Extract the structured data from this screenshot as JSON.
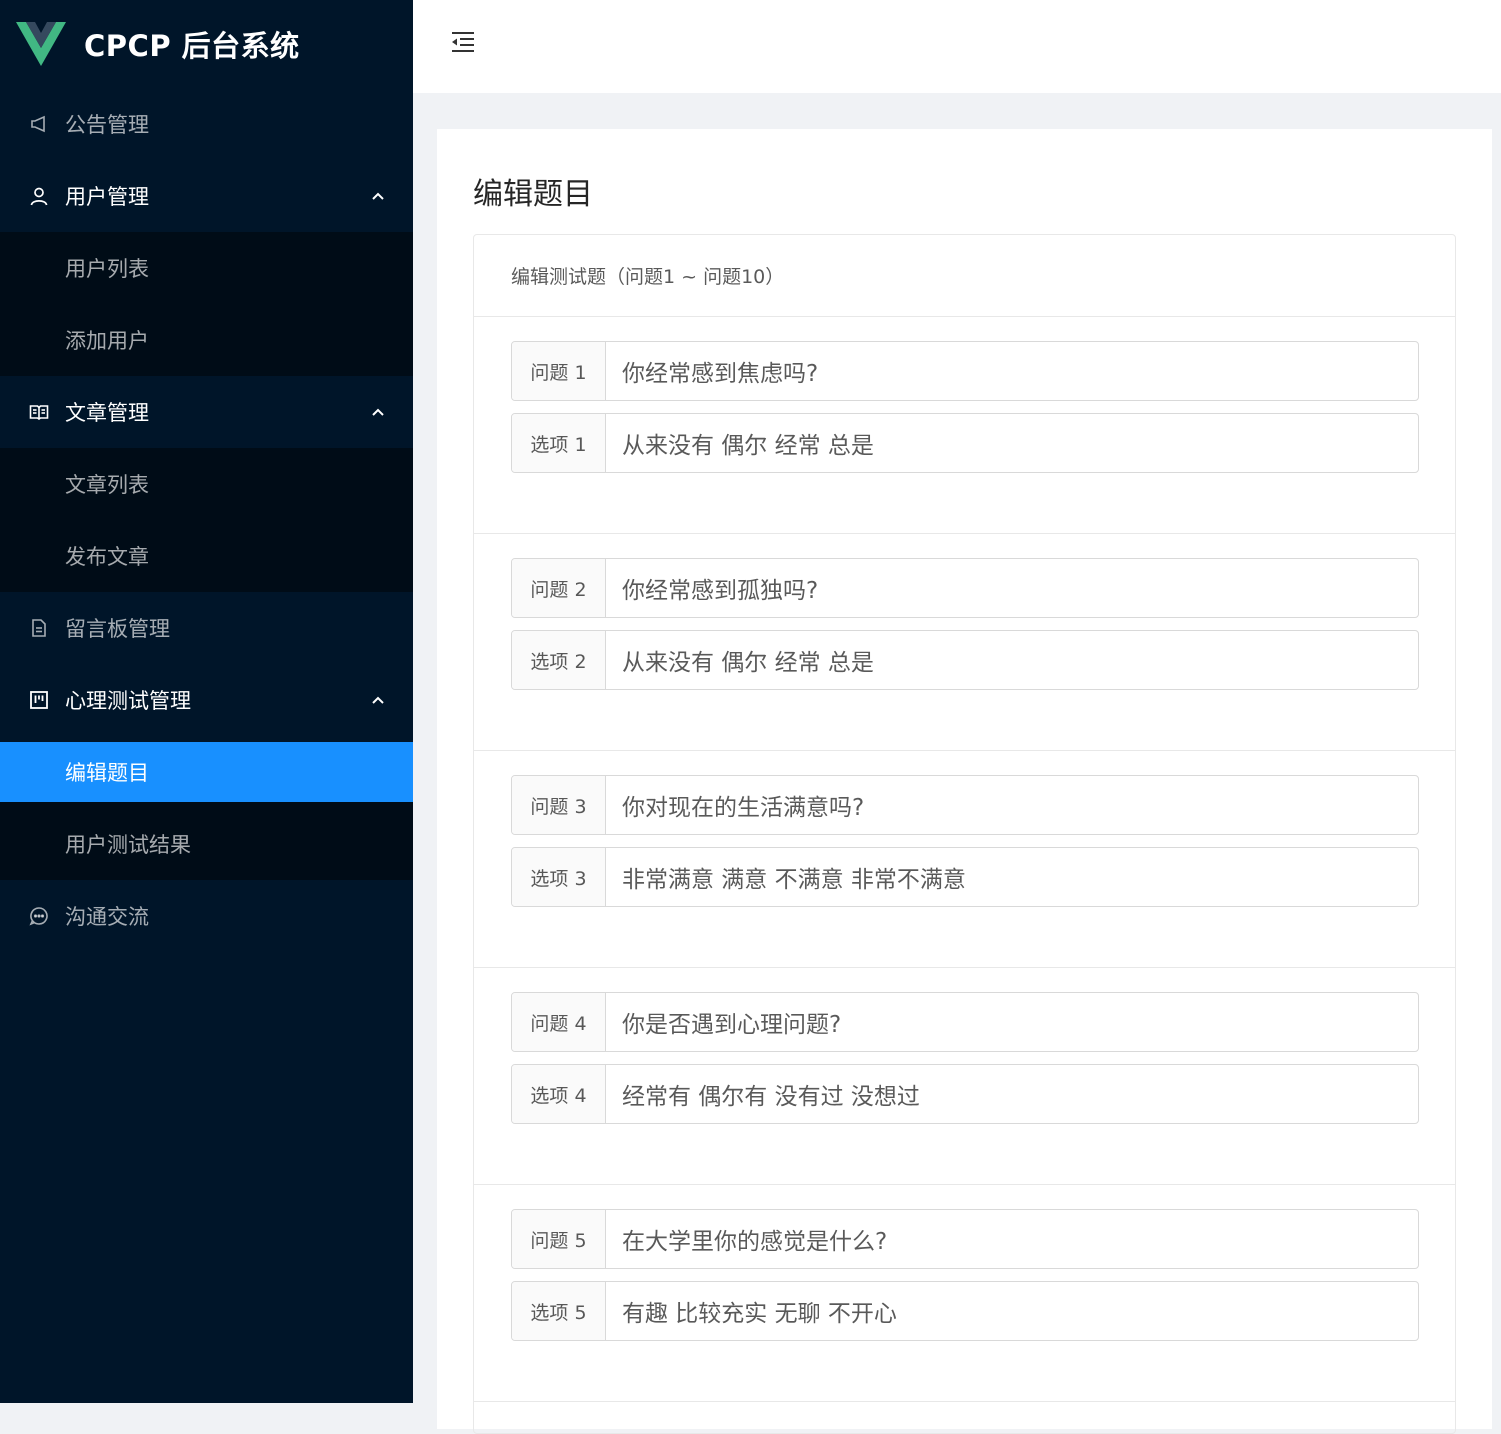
{
  "app": {
    "title": "CPCP 后台系统"
  },
  "sidebar": {
    "items": [
      {
        "label": "公告管理"
      },
      {
        "label": "用户管理",
        "children": [
          "用户列表",
          "添加用户"
        ]
      },
      {
        "label": "文章管理",
        "children": [
          "文章列表",
          "发布文章"
        ]
      },
      {
        "label": "留言板管理"
      },
      {
        "label": "心理测试管理",
        "children": [
          "编辑题目",
          "用户测试结果"
        ]
      },
      {
        "label": "沟通交流"
      }
    ],
    "active": "编辑题目",
    "colors": {
      "bg": "#001529",
      "submenu_bg": "#000c17",
      "active_bg": "#1890ff"
    }
  },
  "main": {
    "page_title": "编辑题目",
    "card_title": "编辑测试题（问题1 ~ 问题10）",
    "questions": [
      {
        "q_label": "问题 1",
        "q_value": "你经常感到焦虑吗?",
        "o_label": "选项 1",
        "o_value": "从来没有 偶尔 经常 总是"
      },
      {
        "q_label": "问题 2",
        "q_value": "你经常感到孤独吗?",
        "o_label": "选项 2",
        "o_value": "从来没有 偶尔 经常 总是"
      },
      {
        "q_label": "问题 3",
        "q_value": "你对现在的生活满意吗?",
        "o_label": "选项 3",
        "o_value": "非常满意 满意 不满意 非常不满意"
      },
      {
        "q_label": "问题 4",
        "q_value": "你是否遇到心理问题?",
        "o_label": "选项 4",
        "o_value": "经常有 偶尔有 没有过 没想过"
      },
      {
        "q_label": "问题 5",
        "q_value": "在大学里你的感觉是什么?",
        "o_label": "选项 5",
        "o_value": "有趣 比较充实 无聊 不开心"
      }
    ]
  }
}
